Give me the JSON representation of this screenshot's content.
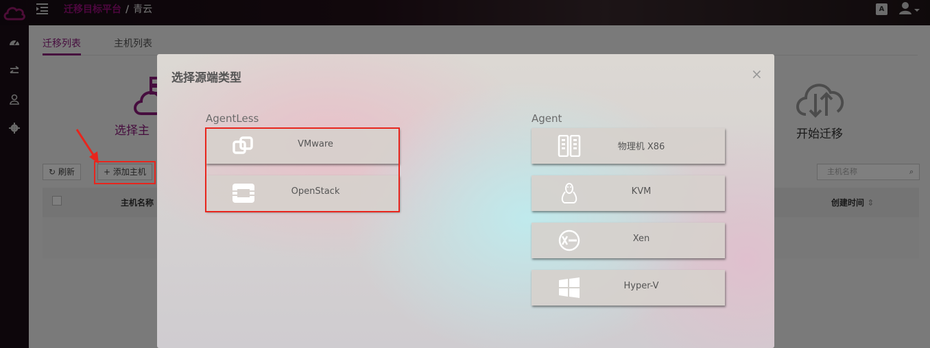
{
  "topbar": {
    "breadcrumb_main": "迁移目标平台",
    "breadcrumb_sep": "/",
    "breadcrumb_current": "青云",
    "lang_label": "A"
  },
  "sidebar": {
    "items": [
      {
        "icon": "dashboard-icon"
      },
      {
        "icon": "transfer-icon"
      },
      {
        "icon": "user-icon"
      },
      {
        "icon": "gear-icon"
      }
    ]
  },
  "main": {
    "tabs": [
      {
        "label": "迁移列表",
        "active": true
      },
      {
        "label": "主机列表",
        "active": false
      }
    ],
    "steps": [
      {
        "label": "选择主"
      },
      {
        "label": "开始迁移"
      }
    ],
    "toolbar": {
      "refresh_label": "刷新",
      "add_host_label": "添加主机",
      "search_placeholder": "主机名称"
    },
    "table": {
      "columns": [
        "主机名称",
        "创建时间"
      ]
    }
  },
  "modal": {
    "title": "选择源端类型",
    "close": "×",
    "agentless": {
      "label": "AgentLess",
      "options": [
        {
          "label": "VMware",
          "icon": "vmware-icon"
        },
        {
          "label": "OpenStack",
          "icon": "openstack-icon"
        }
      ]
    },
    "agent": {
      "label": "Agent",
      "options": [
        {
          "label": "物理机 X86",
          "icon": "server-icon"
        },
        {
          "label": "KVM",
          "icon": "linux-tux-icon"
        },
        {
          "label": "Xen",
          "icon": "xen-icon"
        },
        {
          "label": "Hyper-V",
          "icon": "windows-icon"
        }
      ]
    }
  },
  "colors": {
    "accent": "#8d1a7c",
    "annotation_red": "#e8251d"
  }
}
